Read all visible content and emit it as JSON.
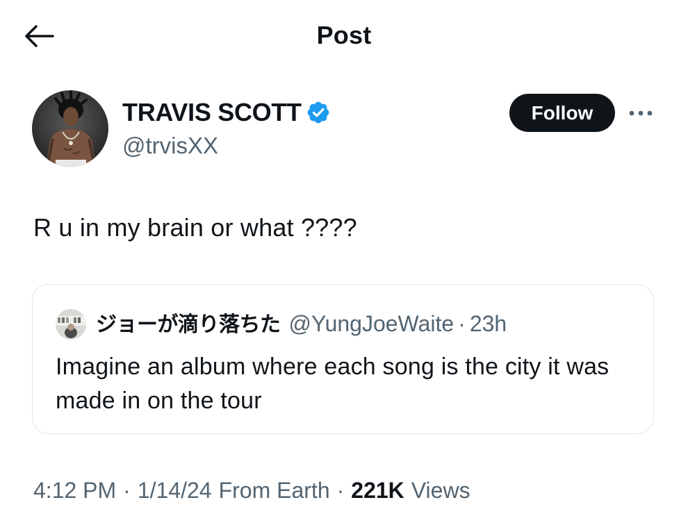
{
  "header": {
    "title": "Post",
    "back_icon": "arrow-left-icon"
  },
  "author": {
    "name": "TRAVIS SCOTT",
    "handle": "@trvisXX",
    "verified": true,
    "verified_color": "#1d9bf0"
  },
  "actions": {
    "follow_label": "Follow",
    "more_icon": "more-horizontal-icon"
  },
  "post": {
    "text": "R u in my brain or what ????"
  },
  "quote": {
    "name": "ジョーが滴り落ちた",
    "handle": "@YungJoeWaite",
    "separator": "·",
    "time": "23h",
    "text": "Imagine an album where each song is the city it was made in on the tour"
  },
  "meta": {
    "time": "4:12 PM",
    "date": "1/14/24",
    "source": "From Earth",
    "separator": "·",
    "views_count": "221K",
    "views_label": "Views"
  },
  "colors": {
    "text": "#0f1419",
    "secondary": "#536471",
    "border": "#e1e6ea",
    "button_bg": "#0f1419"
  }
}
